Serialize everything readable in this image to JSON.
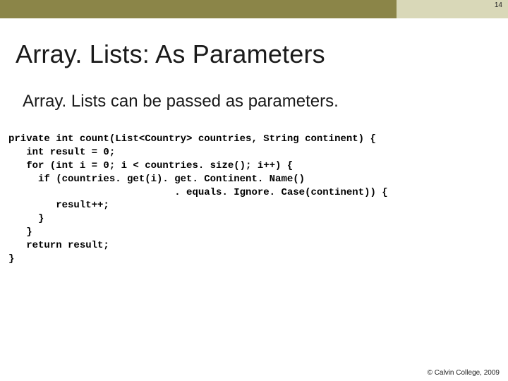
{
  "page_number": "14",
  "title": "Array. Lists: As Parameters",
  "subtitle": "Array. Lists can be passed as parameters.",
  "code": "private int count(List<Country> countries, String continent) {\n   int result = 0;\n   for (int i = 0; i < countries. size(); i++) {\n     if (countries. get(i). get. Continent. Name()\n                            . equals. Ignore. Case(continent)) {\n        result++;\n     }\n   }\n   return result;\n}",
  "footer": "© Calvin College, 2009"
}
